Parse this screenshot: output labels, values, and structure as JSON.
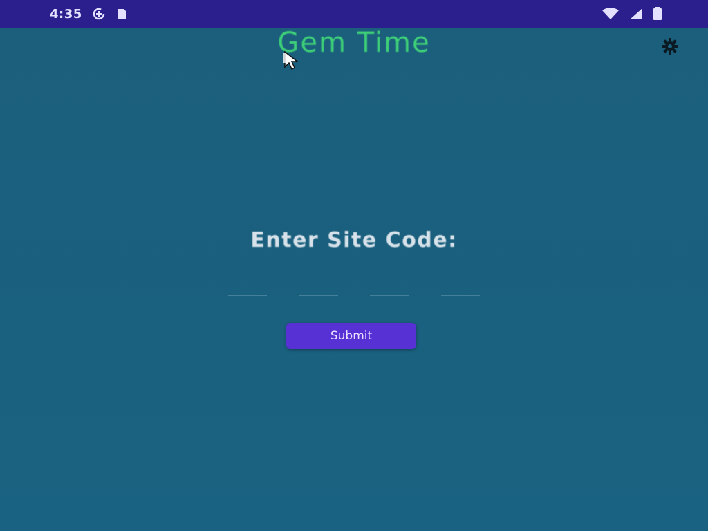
{
  "status_bar": {
    "time": "4:35",
    "left_icons": [
      "data-saver-icon",
      "sim-card-icon"
    ],
    "right_icons": [
      "wifi-icon",
      "signal-icon",
      "battery-icon"
    ],
    "colors": {
      "background": "#2a1f8c",
      "foreground": "#e4e0ff"
    }
  },
  "app": {
    "title": "Gem Time",
    "settings_icon": "gear-icon",
    "prompt_label": "Enter Site Code:",
    "code_inputs": [
      {
        "value": "",
        "placeholder": ""
      },
      {
        "value": "",
        "placeholder": ""
      },
      {
        "value": "",
        "placeholder": ""
      },
      {
        "value": "",
        "placeholder": ""
      }
    ],
    "submit_label": "Submit",
    "colors": {
      "background": "#1a6280",
      "title": "#3ed078",
      "label": "#d8e2ea",
      "button": "#5731d4"
    }
  }
}
